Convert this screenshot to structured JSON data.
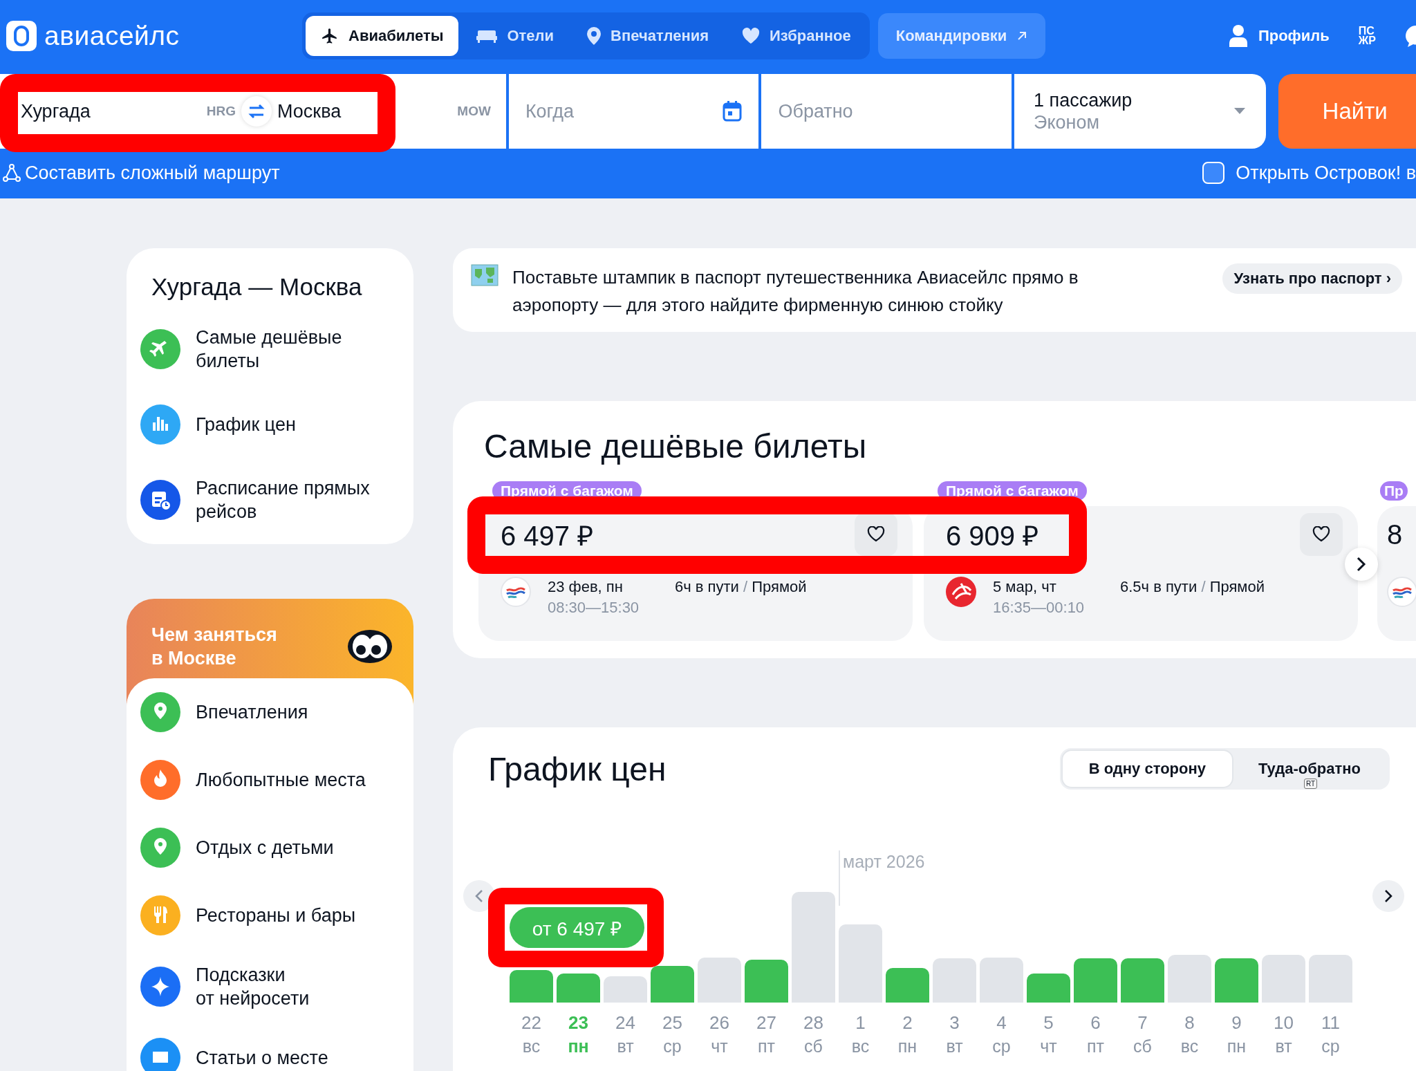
{
  "header": {
    "logo": "авиасейлс",
    "nav": [
      {
        "label": "Авиабилеты",
        "selected": true
      },
      {
        "label": "Отели",
        "selected": false
      },
      {
        "label": "Впечатления",
        "selected": false
      },
      {
        "label": "Избранное",
        "selected": false
      }
    ],
    "business_link": "Командировки",
    "profile": "Профиль",
    "partner_logo": [
      "ПС",
      "ЖР"
    ]
  },
  "search": {
    "origin": "Хургада",
    "origin_code": "HRG",
    "destination": "Москва",
    "destination_code": "MOW",
    "depart_placeholder": "Когда",
    "return_placeholder": "Обратно",
    "passengers": "1 пассажир",
    "cabin": "Эконом",
    "submit": "Найти",
    "highlighted": true,
    "complex_route": "Составить сложный маршрут",
    "ostrovok": {
      "label": "Открыть Островок! в",
      "checked": false
    }
  },
  "route_card": {
    "title": "Хургада — Москва",
    "items": [
      {
        "kind": "plane",
        "label": "Самые дешёвые билеты"
      },
      {
        "kind": "chart",
        "label": "График цен"
      },
      {
        "kind": "schedule",
        "label": "Расписание прямых рейсов"
      }
    ]
  },
  "activities": {
    "title": "Чем заняться в Москве",
    "items": [
      {
        "kind": "pin",
        "label": "Впечатления"
      },
      {
        "kind": "fire",
        "label": "Любопытные места"
      },
      {
        "kind": "pin",
        "label": "Отдых с детьми"
      },
      {
        "kind": "food",
        "label": "Рестораны и бары"
      },
      {
        "kind": "spark",
        "label": "Подсказки\nот нейросети"
      },
      {
        "kind": "logo",
        "label": "Статьи о месте"
      }
    ]
  },
  "banner": {
    "text": "Поставьте штампик в паспорт путешественника Авиасейлс прямо в аэропорту — для этого найдите фирменную синюю стойку",
    "button": "Узнать про паспорт ›"
  },
  "tickets": {
    "title": "Самые дешёвые билеты",
    "price_highlight": true,
    "items": [
      {
        "tag": "Прямой с багажом",
        "price": "6 497 ₽",
        "kind": "wave",
        "date": "23 фев, пн",
        "times": "08:30—15:30",
        "duration": "6ч в пути",
        "separator": "/",
        "route_type": "Прямой"
      },
      {
        "tag": "Прямой с багажом",
        "price": "6 909 ₽",
        "kind": "red",
        "date": "5 мар, чт",
        "times": "16:35—00:10",
        "duration": "6.5ч в пути",
        "separator": "/",
        "route_type": "Прямой"
      },
      {
        "tag": "Пр",
        "price": "8",
        "kind": "wave"
      }
    ]
  },
  "price_chart": {
    "title": "График цен",
    "toggle": [
      {
        "label": "В одну сторону",
        "selected": true
      },
      {
        "label": "Туда-обратно",
        "selected": false,
        "hint": "RT"
      }
    ],
    "badge": "от 6 497 ₽",
    "badge_highlight": true,
    "days": [
      {
        "day": "22",
        "weekday": "вс",
        "cheap": true,
        "selected": false
      },
      {
        "day": "23",
        "weekday": "пн",
        "cheap": true,
        "selected": true
      },
      {
        "day": "24",
        "weekday": "вт",
        "cheap": false,
        "selected": false
      },
      {
        "day": "25",
        "weekday": "ср",
        "cheap": true,
        "selected": false
      },
      {
        "day": "26",
        "weekday": "чт",
        "cheap": false,
        "selected": false
      },
      {
        "day": "27",
        "weekday": "пт",
        "cheap": true,
        "selected": false
      },
      {
        "day": "28",
        "weekday": "сб",
        "cheap": false,
        "selected": false
      },
      {
        "day": "1",
        "weekday": "вс",
        "cheap": false,
        "selected": false,
        "month_label": "март 2026"
      },
      {
        "day": "2",
        "weekday": "пн",
        "cheap": true,
        "selected": false
      },
      {
        "day": "3",
        "weekday": "вт",
        "cheap": false,
        "selected": false
      },
      {
        "day": "4",
        "weekday": "ср",
        "cheap": false,
        "selected": false
      },
      {
        "day": "5",
        "weekday": "чт",
        "cheap": true,
        "selected": false
      },
      {
        "day": "6",
        "weekday": "пт",
        "cheap": true,
        "selected": false
      },
      {
        "day": "7",
        "weekday": "сб",
        "cheap": true,
        "selected": false
      },
      {
        "day": "8",
        "weekday": "вс",
        "cheap": false,
        "selected": false
      },
      {
        "day": "9",
        "weekday": "пн",
        "cheap": true,
        "selected": false
      },
      {
        "day": "10",
        "weekday": "вт",
        "cheap": false,
        "selected": false
      },
      {
        "day": "11",
        "weekday": "ср",
        "cheap": false,
        "selected": false
      }
    ]
  }
}
